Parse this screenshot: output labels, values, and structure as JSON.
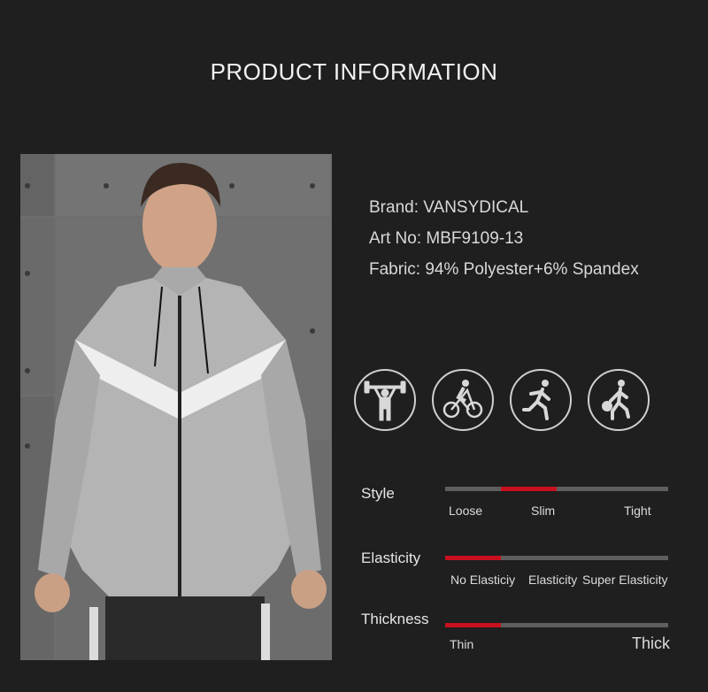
{
  "header": {
    "title": "PRODUCT INFORMATION"
  },
  "product": {
    "brand": "Brand: VANSYDICAL",
    "art_no": "Art No: MBF9109-13",
    "fabric": "Fabric: 94% Polyester+6% Spandex"
  },
  "activity_icons": [
    "weightlifting-icon",
    "cycling-icon",
    "running-icon",
    "basketball-icon"
  ],
  "attributes": {
    "style": {
      "label": "Style",
      "options": [
        "Loose",
        "Slim",
        "Tight"
      ],
      "selected": "Slim",
      "level": [
        0.25,
        0.5
      ]
    },
    "elasticity": {
      "label": "Elasticity",
      "options": [
        "No Elasticiy",
        "Elasticity",
        "Super Elasticity"
      ],
      "selected": "No Elasticiy",
      "level": [
        0,
        0.25
      ]
    },
    "thickness": {
      "label": "Thickness",
      "options": [
        "Thin",
        "Thick"
      ],
      "selected": "Thin",
      "level": [
        0,
        0.25
      ]
    }
  },
  "colors": {
    "background": "#1f1f1f",
    "accent": "#c8101e",
    "track": "#5e5e5e"
  }
}
